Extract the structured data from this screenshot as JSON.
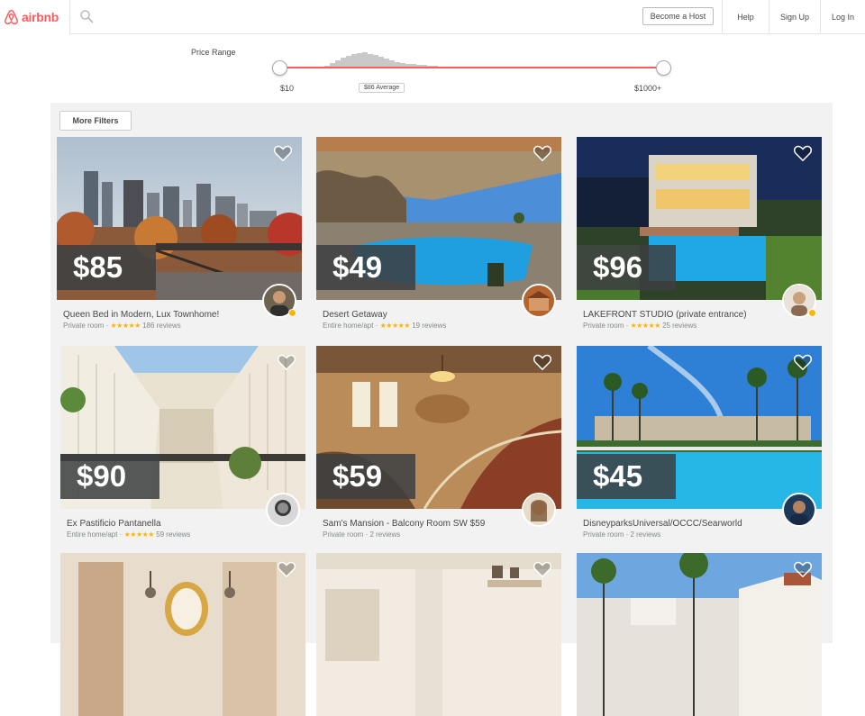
{
  "header": {
    "brand": "airbnb",
    "nav": {
      "host": "Become a Host",
      "help": "Help",
      "signup": "Sign Up",
      "login": "Log In"
    }
  },
  "filters": {
    "price_range_label": "Price Range",
    "min": "$10",
    "max": "$1000+",
    "average": "$86 Average",
    "more_filters": "More Filters"
  },
  "listings": [
    {
      "price": "$85",
      "title": "Queen Bed in Modern, Lux Townhome!",
      "room_type": "Private room",
      "stars": "★★★★★",
      "reviews": "186 reviews"
    },
    {
      "price": "$49",
      "title": "Desert Getaway",
      "room_type": "Entire home/apt",
      "stars": "★★★★★",
      "reviews": "19 reviews"
    },
    {
      "price": "$96",
      "title": "LAKEFRONT STUDIO (private entrance)",
      "room_type": "Private room",
      "stars": "★★★★★",
      "reviews": "25 reviews"
    },
    {
      "price": "$90",
      "title": "Ex Pastificio Pantanella",
      "room_type": "Entire home/apt",
      "stars": "★★★★★",
      "reviews": "59 reviews"
    },
    {
      "price": "$59",
      "title": "Sam's Mansion - Balcony Room SW $59",
      "room_type": "Private room",
      "reviews": "2 reviews"
    },
    {
      "price": "$45",
      "title": "DisneyparksUniversal/OCCC/Searworld",
      "room_type": "Private room",
      "reviews": "2 reviews"
    }
  ],
  "colors": {
    "brand": "#ff5a5f",
    "star": "#ffb400"
  }
}
